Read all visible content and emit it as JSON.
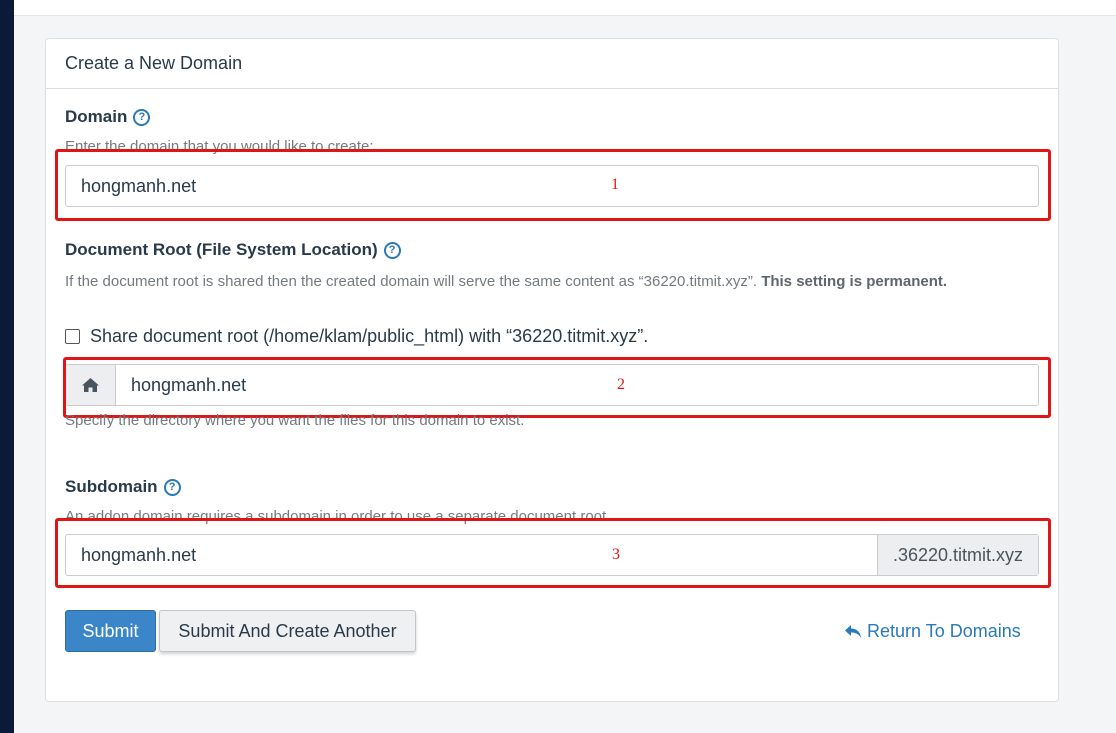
{
  "panel": {
    "heading": "Create a New Domain"
  },
  "domain": {
    "label": "Domain",
    "hint": "Enter the domain that you would like to create:",
    "value": "hongmanh.net",
    "marker": "1"
  },
  "docroot": {
    "label": "Document Root (File System Location)",
    "hint": "If the document root is shared then the created domain will serve the same content as “36220.titmit.xyz”.",
    "hint_bold": "This setting is permanent.",
    "share_label": "Share document root (/home/klam/public_html) with “36220.titmit.xyz”.",
    "share_checked": false,
    "value": "hongmanh.net",
    "marker": "2",
    "help_text": "Specify the directory where you want the files for this domain to exist.",
    "icon": "home-icon"
  },
  "subdomain": {
    "label": "Subdomain",
    "hint": "An addon domain requires a subdomain in order to use a separate document root.",
    "value": "hongmanh.net",
    "suffix": ".36220.titmit.xyz",
    "marker": "3"
  },
  "actions": {
    "submit": "Submit",
    "submit_another": "Submit And Create Another",
    "return": "Return To Domains"
  },
  "colors": {
    "annotation": "#e01515",
    "primary": "#3a86c8",
    "link": "#2a79b8"
  }
}
